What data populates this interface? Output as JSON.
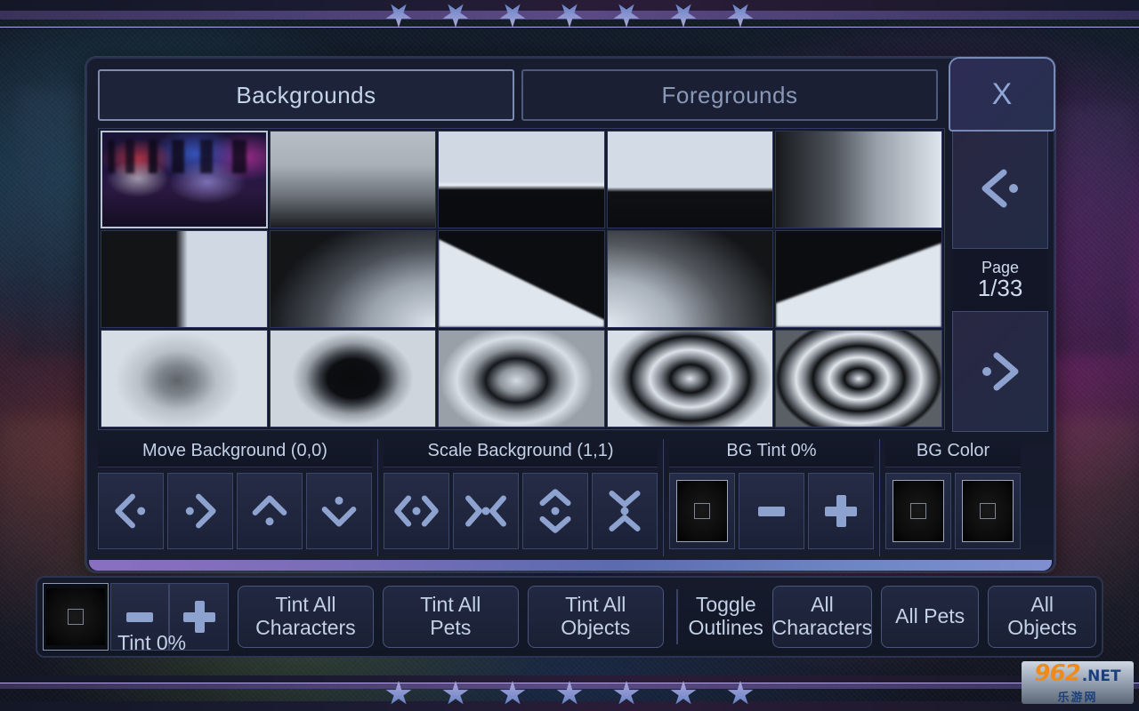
{
  "dialog": {
    "tabs": [
      {
        "label": "Backgrounds",
        "active": true
      },
      {
        "label": "Foregrounds",
        "active": false
      }
    ],
    "close_label": "X",
    "page": {
      "label": "Page",
      "value": "1/33",
      "current": 1,
      "total": 33
    },
    "prev_icon": "chevron-left-dot-icon",
    "next_icon": "chevron-right-dot-icon"
  },
  "thumbnails": [
    {
      "index": 1,
      "name": "neon-city-skyline",
      "selected": true
    },
    {
      "index": 2,
      "name": "vertical-white-to-black-gradient",
      "selected": false
    },
    {
      "index": 3,
      "name": "white-band-over-black",
      "selected": false
    },
    {
      "index": 4,
      "name": "white-top-black-bottom",
      "selected": false
    },
    {
      "index": 5,
      "name": "horizontal-black-to-white-gradient",
      "selected": false
    },
    {
      "index": 6,
      "name": "vertical-half-black-half-white",
      "selected": false
    },
    {
      "index": 7,
      "name": "corner-radial-gradient-bottom-right",
      "selected": false
    },
    {
      "index": 8,
      "name": "black-wedge-diagonal",
      "selected": false
    },
    {
      "index": 9,
      "name": "corner-radial-gradient-bottom-left",
      "selected": false
    },
    {
      "index": 10,
      "name": "diagonal-split-wedge",
      "selected": false
    },
    {
      "index": 11,
      "name": "soft-radial-light",
      "selected": false
    },
    {
      "index": 12,
      "name": "dark-radial-disc",
      "selected": false
    },
    {
      "index": 13,
      "name": "single-ring-radial",
      "selected": false
    },
    {
      "index": 14,
      "name": "double-ring-radial",
      "selected": false
    },
    {
      "index": 15,
      "name": "triple-ring-radial",
      "selected": false
    }
  ],
  "controls": {
    "move_background": {
      "label": "Move Background (0,0)",
      "value": "(0,0)",
      "buttons": [
        {
          "name": "move-left-button",
          "icon": "chevron-left-dot-icon"
        },
        {
          "name": "move-right-button",
          "icon": "chevron-right-dot-icon"
        },
        {
          "name": "move-up-button",
          "icon": "chevron-up-dot-icon"
        },
        {
          "name": "move-down-button",
          "icon": "chevron-down-dot-icon"
        }
      ]
    },
    "scale_background": {
      "label": "Scale Background (1,1)",
      "value": "(1,1)",
      "buttons": [
        {
          "name": "scale-expand-horizontal-button",
          "icon": "expand-horizontal-icon"
        },
        {
          "name": "scale-shrink-horizontal-button",
          "icon": "contract-horizontal-icon"
        },
        {
          "name": "scale-expand-vertical-button",
          "icon": "expand-vertical-icon"
        },
        {
          "name": "scale-shrink-vertical-button",
          "icon": "contract-vertical-icon"
        }
      ]
    },
    "bg_tint": {
      "label": "BG Tint 0%",
      "value": "0%",
      "swatch_name": "bg-tint-color-swatch",
      "minus_label": "minus-icon",
      "plus_label": "plus-icon"
    },
    "bg_color": {
      "label": "BG Color",
      "swatches": [
        {
          "name": "bg-color-swatch-primary"
        },
        {
          "name": "bg-color-swatch-secondary"
        }
      ]
    }
  },
  "toolbar": {
    "tint_swatch_name": "global-tint-color-swatch",
    "tint_label": "Tint 0%",
    "tint_value": "0%",
    "minus_icon": "minus-icon",
    "plus_icon": "plus-icon",
    "buttons": [
      {
        "name": "tint-all-characters-button",
        "label": "Tint All\nCharacters"
      },
      {
        "name": "tint-all-pets-button",
        "label": "Tint All\nPets"
      },
      {
        "name": "tint-all-objects-button",
        "label": "Tint All\nObjects"
      }
    ],
    "toggle_outlines_label": "Toggle\nOutlines",
    "outline_buttons": [
      {
        "name": "all-characters-button",
        "label": "All\nCharacters"
      },
      {
        "name": "all-pets-button",
        "label": "All Pets"
      },
      {
        "name": "all-objects-button",
        "label": "All\nObjects"
      }
    ]
  },
  "watermark": {
    "number": "962",
    "domain": ".NET",
    "subtitle": "乐游网"
  },
  "decor": {
    "star_count_top": 7,
    "star_count_bottom": 7
  },
  "colors": {
    "panel_bg": "#171c2e",
    "panel_border": "#2b3350",
    "text": "#c3d0e6",
    "icon": "#8da2cf",
    "accent_bar": "#8a6fc0",
    "star": "#8b93cf"
  }
}
